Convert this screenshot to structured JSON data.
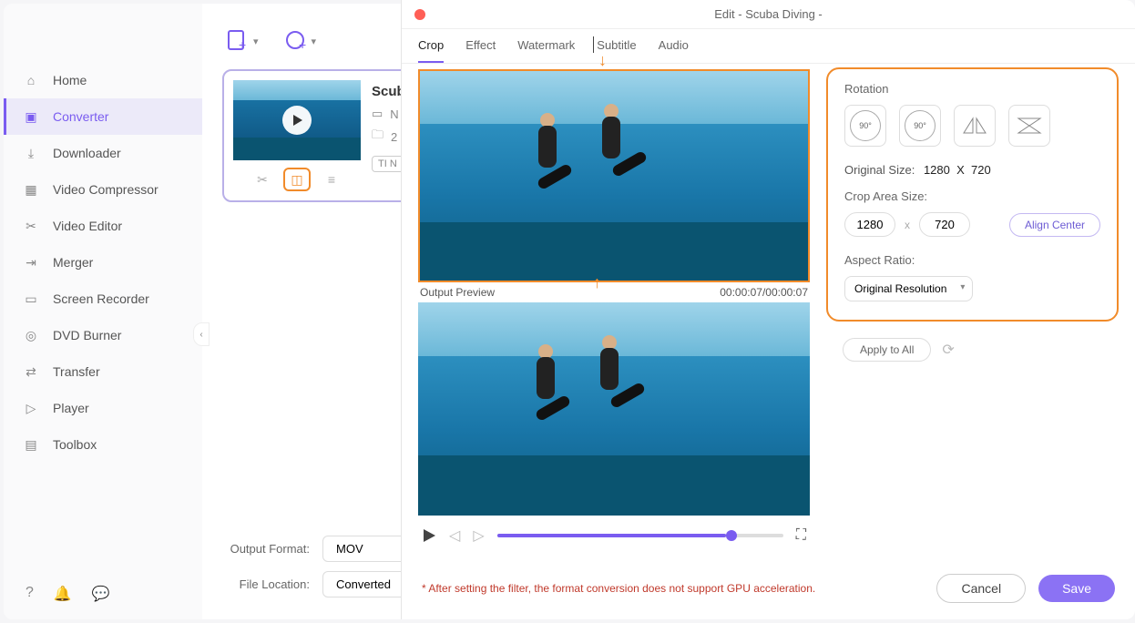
{
  "sidebar": {
    "items": [
      {
        "label": "Home"
      },
      {
        "label": "Converter"
      },
      {
        "label": "Downloader"
      },
      {
        "label": "Video Compressor"
      },
      {
        "label": "Video Editor"
      },
      {
        "label": "Merger"
      },
      {
        "label": "Screen Recorder"
      },
      {
        "label": "DVD Burner"
      },
      {
        "label": "Transfer"
      },
      {
        "label": "Player"
      },
      {
        "label": "Toolbox"
      }
    ]
  },
  "card": {
    "title": "Scub",
    "meta1_prefix": "N",
    "meta2_prefix": "2",
    "format_label": "TI  N"
  },
  "footer": {
    "output_label": "Output Format:",
    "output_value": "MOV",
    "loc_label": "File Location:",
    "loc_value": "Converted"
  },
  "edit": {
    "title": "Edit - Scuba Diving -",
    "tabs": [
      "Crop",
      "Effect",
      "Watermark",
      "Subtitle",
      "Audio"
    ],
    "preview_label": "Output Preview",
    "time": "00:00:07/00:00:07",
    "rotation_label": "Rotation",
    "rot_90a": "90°",
    "rot_90b": "90°",
    "orig_size_label": "Original Size:",
    "orig_w": "1280",
    "orig_h": "720",
    "crop_label": "Crop Area Size:",
    "crop_w": "1280",
    "crop_h": "720",
    "align": "Align Center",
    "ratio_label": "Aspect Ratio:",
    "ratio_value": "Original Resolution",
    "apply": "Apply to All",
    "warn": "* After setting the filter, the format conversion does not support GPU acceleration.",
    "cancel": "Cancel",
    "save": "Save"
  }
}
